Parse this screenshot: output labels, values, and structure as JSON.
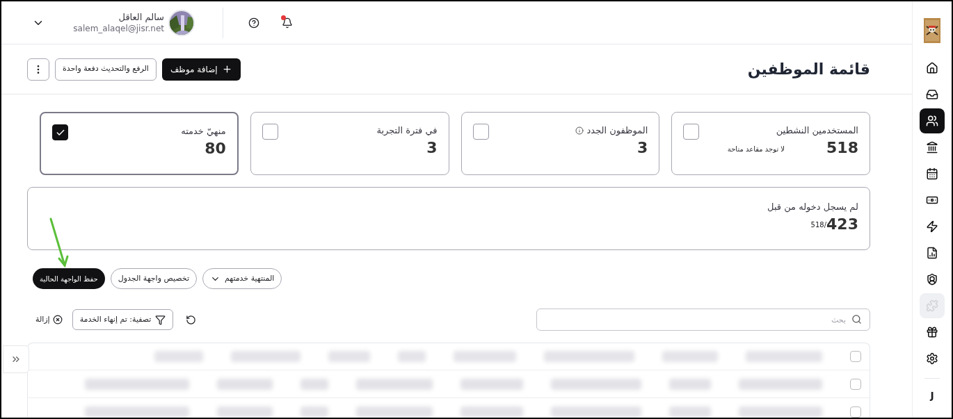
{
  "top_bar": {
    "user_name": "سالم العاقل",
    "user_email": "salem_alaqel@jisr.net",
    "notification_dot": true
  },
  "page_title": "قائمة الموظفين",
  "header_buttons": {
    "add": "إضافة موظف",
    "upload": "الرفع والتحديث دفعة واحدة"
  },
  "stat_cards": [
    {
      "title": "المستخدمين النشطين",
      "value": "518",
      "note": "لا توجد مقاعد متاحة",
      "info": false,
      "selected": false
    },
    {
      "title": "الموظفون الجدد",
      "value": "3",
      "info": true,
      "selected": false
    },
    {
      "title": "في فترة التجربة",
      "value": "3",
      "info": false,
      "selected": false
    },
    {
      "title": "منهيّ خدمته",
      "value": "80",
      "info": false,
      "selected": true
    }
  ],
  "login_card": {
    "title": "لم يسجل دخوله من قبل",
    "value": "423",
    "total": "518/"
  },
  "view_bar": {
    "dropdown": "المنتهية خدمتهم",
    "customize": "تخصيص واجهة الجدول",
    "save": "حفظ الواجهة الحالية"
  },
  "search": {
    "placeholder": "بحث"
  },
  "filter_chip": "تصفية: تم إنهاء الخدمة",
  "remove_filter": "إزالة",
  "table": {
    "header_checked": false,
    "rows": [
      {
        "checked": false
      },
      {
        "checked": false
      }
    ]
  },
  "sidebar": {
    "items": [
      {
        "selected": false,
        "disabled": false
      },
      {
        "selected": false,
        "disabled": false
      },
      {
        "selected": true,
        "disabled": false
      },
      {
        "selected": false,
        "disabled": false
      },
      {
        "selected": false,
        "disabled": false
      },
      {
        "selected": false,
        "disabled": false
      },
      {
        "selected": false,
        "disabled": false
      },
      {
        "selected": false,
        "disabled": false
      },
      {
        "selected": false,
        "disabled": false
      },
      {
        "selected": false,
        "disabled": true
      },
      {
        "selected": false,
        "disabled": false
      },
      {
        "selected": false,
        "disabled": false
      }
    ],
    "language": "J"
  }
}
